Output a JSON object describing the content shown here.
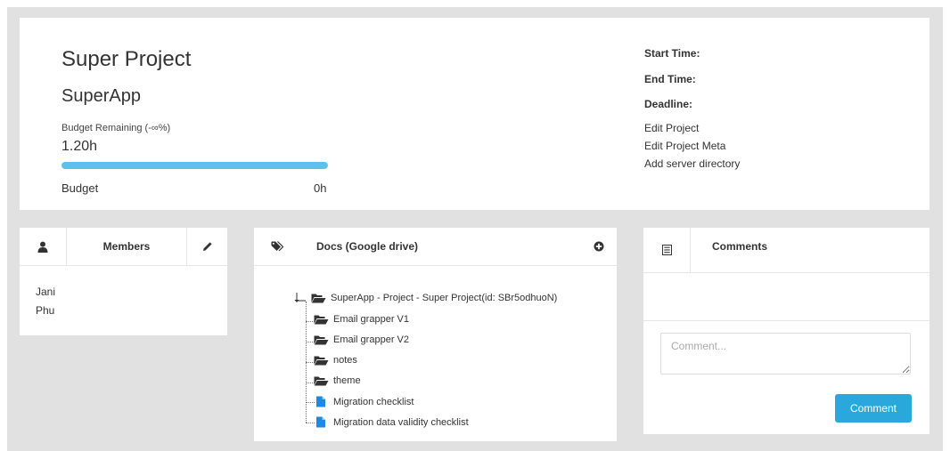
{
  "project": {
    "title": "Super Project",
    "app_name": "SuperApp",
    "budget_remaining_label": "Budget Remaining (-∞%)",
    "hours": "1.20h",
    "budget_bar_fill_percent": 100,
    "budget_label": "Budget",
    "budget_value": "0h"
  },
  "meta": {
    "start_time_label": "Start Time:",
    "end_time_label": "End Time:",
    "deadline_label": "Deadline:",
    "links": [
      "Edit Project",
      "Edit Project Meta",
      "Add server directory"
    ]
  },
  "members_panel": {
    "title": "Members",
    "members": [
      "Jani",
      "Phu"
    ]
  },
  "docs_panel": {
    "title": "Docs (Google drive)",
    "root": "SuperApp - Project - Super Project(id: SBr5odhuoN)",
    "items": [
      {
        "name": "Email grapper V1",
        "type": "folder"
      },
      {
        "name": "Email grapper V2",
        "type": "folder"
      },
      {
        "name": "notes",
        "type": "folder"
      },
      {
        "name": "theme",
        "type": "folder"
      },
      {
        "name": "Migration checklist",
        "type": "file"
      },
      {
        "name": "Migration data validity checklist",
        "type": "file"
      }
    ]
  },
  "comments_panel": {
    "title": "Comments",
    "placeholder": "Comment...",
    "submit_label": "Comment"
  },
  "colors": {
    "accent": "#2aa8dc",
    "progress": "#5fc0ee",
    "file_icon": "#1e88e5",
    "background": "#e1e1e1"
  }
}
